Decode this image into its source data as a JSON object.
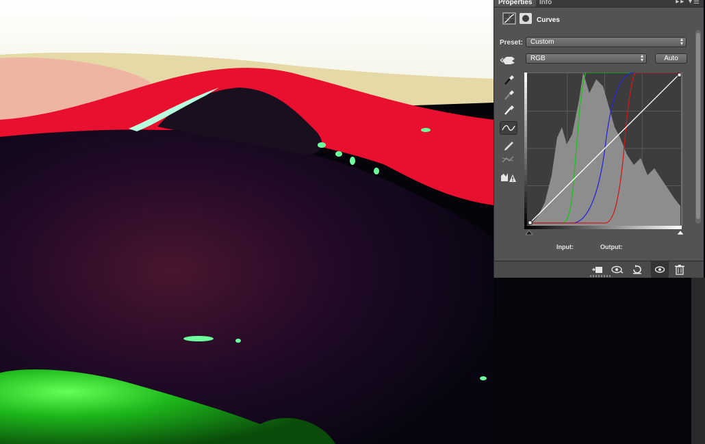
{
  "properties_panel": {
    "tabs": [
      {
        "label": "Properties",
        "active": true
      },
      {
        "label": "Info",
        "active": false
      }
    ],
    "tab_menu_glyph": "▸▸ ▾☰",
    "header": {
      "title": "Curves",
      "icons": [
        "curves-adjustment-icon",
        "layer-mask-icon"
      ]
    },
    "preset": {
      "label": "Preset:",
      "value": "Custom"
    },
    "channel": {
      "value": "RGB"
    },
    "auto_button": {
      "label": "Auto"
    },
    "tools": [
      "on-image-adjust-icon",
      "black-point-eyedropper-icon",
      "gray-point-eyedropper-icon",
      "white-point-eyedropper-icon",
      "edit-points-curve-icon",
      "pencil-draw-icon",
      "smooth-curve-icon",
      "clipping-warning-icon"
    ],
    "input_label": "Input:",
    "output_label": "Output:",
    "bottom_icons": [
      "clip-to-layer-icon",
      "view-previous-state-icon",
      "reset-adjustments-icon",
      "toggle-visibility-icon",
      "delete-layer-icon"
    ]
  },
  "colors": {
    "panel_bg": "#535353",
    "graph_bg": "#3d3d3d",
    "histogram": "#8d8d8d",
    "curve_red": "#d01818",
    "curve_green": "#19c319",
    "curve_blue": "#2626d8",
    "curve_composite": "#ffffff"
  }
}
